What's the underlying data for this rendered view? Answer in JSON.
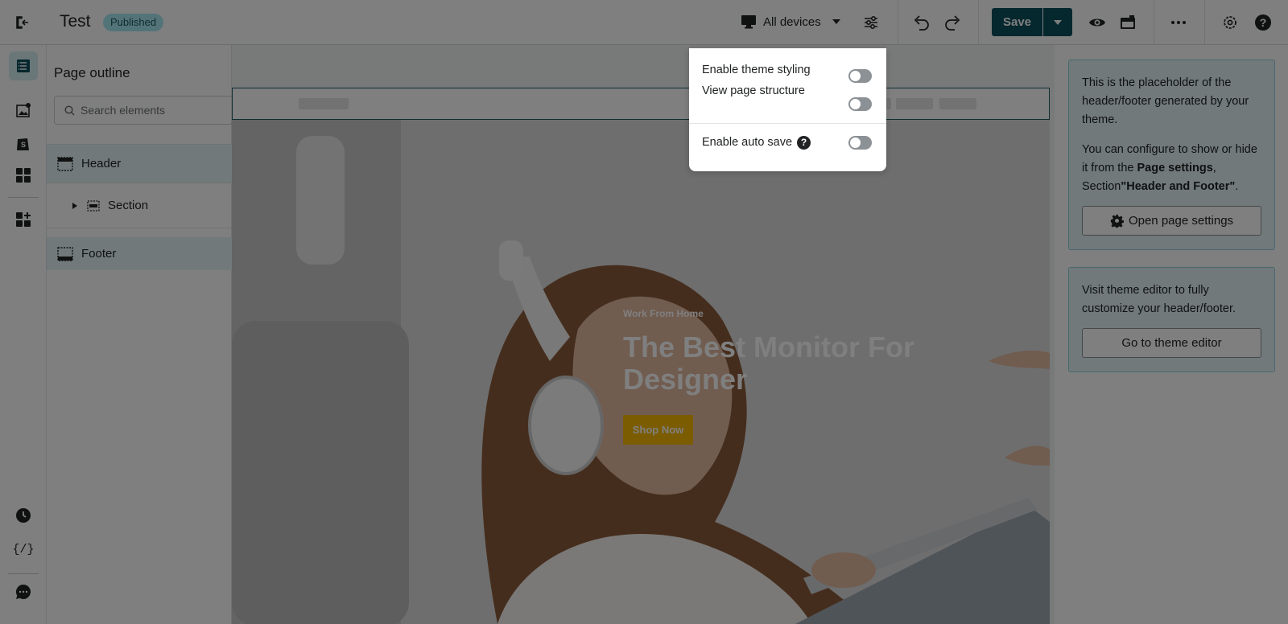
{
  "topbar": {
    "title": "Test",
    "status_badge": "Published",
    "device_selector": "All devices",
    "save_label": "Save"
  },
  "outline": {
    "heading": "Page outline",
    "search_placeholder": "Search elements",
    "items": [
      {
        "label": "Header"
      },
      {
        "label": "Section"
      },
      {
        "label": "Footer"
      }
    ]
  },
  "hero": {
    "subtitle": "Work From Home",
    "title": "The Best Monitor For Designer",
    "cta": "Shop Now"
  },
  "right_panel": {
    "card1": {
      "text1": "This is the placeholder of the header/footer generated by your theme.",
      "text2_prefix": "You can configure to show or hide it from the ",
      "text2_bold1": "Page settings",
      "text2_mid": ", Section",
      "text2_bold2": "\"Header and Footer\"",
      "text2_suffix": ".",
      "button": "Open page settings"
    },
    "card2": {
      "text": "Visit theme editor to fully customize your header/footer.",
      "button": "Go to theme editor"
    }
  },
  "popover": {
    "items": [
      {
        "label": "Enable theme styling",
        "enabled": false
      },
      {
        "label": "View page structure",
        "enabled": false
      },
      {
        "label": "Enable auto save",
        "enabled": false
      }
    ]
  },
  "colors": {
    "accent": "#0b4f5c",
    "badge_bg": "#a4e8f2",
    "cta": "#f7b800",
    "highlight": "#e3f3f6"
  }
}
